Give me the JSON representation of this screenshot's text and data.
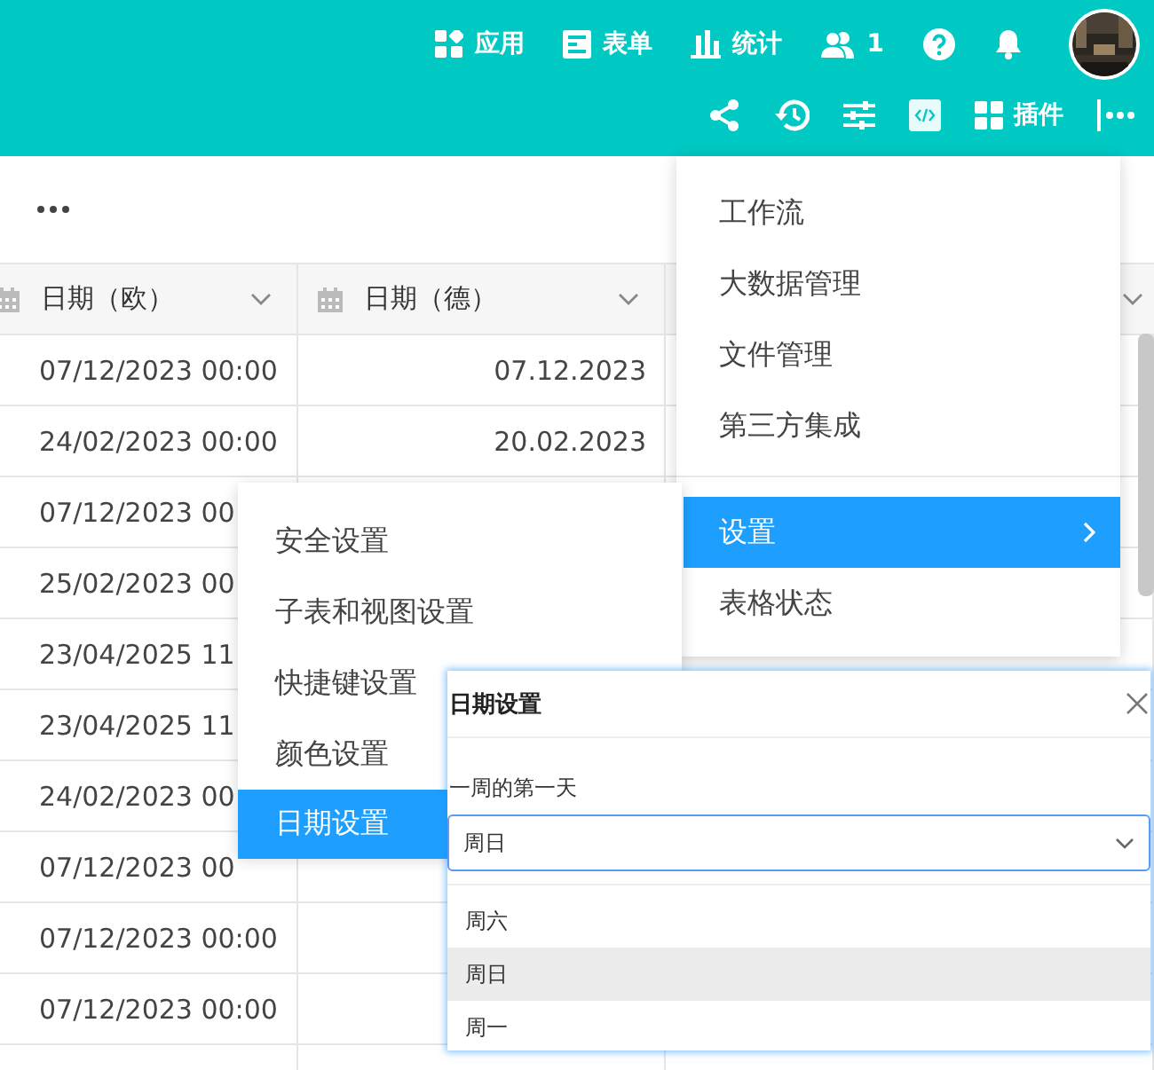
{
  "topbar": {
    "items": [
      {
        "kind": "apps",
        "label": "应用"
      },
      {
        "kind": "form",
        "label": "表单"
      },
      {
        "kind": "stats",
        "label": "统计"
      },
      {
        "kind": "users",
        "label": "1"
      },
      {
        "kind": "help"
      },
      {
        "kind": "bell"
      },
      {
        "kind": "avatar"
      }
    ],
    "tools": [
      {
        "kind": "share"
      },
      {
        "kind": "history"
      },
      {
        "kind": "sliders"
      },
      {
        "kind": "code"
      },
      {
        "kind": "plugins",
        "label": "插件"
      },
      {
        "kind": "more"
      }
    ]
  },
  "table": {
    "columns": [
      "日期（欧）",
      "日期（德）"
    ],
    "rows": [
      [
        "07/12/2023 00:00",
        "07.12.2023"
      ],
      [
        "24/02/2023 00:00",
        "20.02.2023"
      ],
      [
        "07/12/2023 00"
      ],
      [
        "25/02/2023 00"
      ],
      [
        "23/04/2025 11"
      ],
      [
        "23/04/2025 11"
      ],
      [
        "24/02/2023 00"
      ],
      [
        "07/12/2023 00"
      ],
      [
        "07/12/2023 00:00"
      ],
      [
        "07/12/2023 00:00"
      ]
    ]
  },
  "menu": {
    "items": [
      {
        "kind": "item",
        "label": "工作流",
        "selected": false,
        "submenu": false
      },
      {
        "kind": "item",
        "label": "大数据管理",
        "selected": false,
        "submenu": false
      },
      {
        "kind": "item",
        "label": "文件管理",
        "selected": false,
        "submenu": false
      },
      {
        "kind": "item",
        "label": "第三方集成",
        "selected": false,
        "submenu": false
      },
      {
        "kind": "divider"
      },
      {
        "kind": "item",
        "label": "设置",
        "selected": true,
        "submenu": true
      },
      {
        "kind": "item",
        "label": "表格状态",
        "selected": false,
        "submenu": false
      }
    ]
  },
  "submenu": {
    "items": [
      {
        "label": "安全设置",
        "selected": false
      },
      {
        "label": "子表和视图设置",
        "selected": false
      },
      {
        "label": "快捷键设置",
        "selected": false
      },
      {
        "label": "颜色设置",
        "selected": false
      },
      {
        "label": "日期设置",
        "selected": true
      }
    ]
  },
  "dialog": {
    "title": "日期设置",
    "field_label": "一周的第一天",
    "value": "周日",
    "options": [
      {
        "label": "周六",
        "selected": false
      },
      {
        "label": "周日",
        "selected": true
      },
      {
        "label": "周一",
        "selected": false
      }
    ]
  }
}
